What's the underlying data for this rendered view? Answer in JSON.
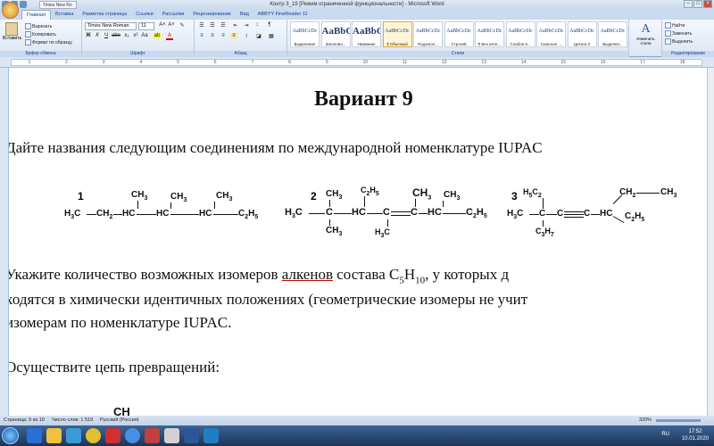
{
  "titlebar": {
    "doc_tab": "Times New Ro",
    "title": "Контр 3_19 [Режим ограниченной функциональности] - Microsoft Word"
  },
  "tabs": [
    "Главная",
    "Вставка",
    "Разметка страницы",
    "Ссылки",
    "Рассылки",
    "Рецензирование",
    "Вид",
    "ABBYY FineReader 11"
  ],
  "ribbon": {
    "paste": "Вставить",
    "cut": "Вырезать",
    "copy": "Копировать",
    "format_painter": "Формат по образцу",
    "font_name": "Times New Roman",
    "font_size": "11",
    "groups": [
      "Буфер обмена",
      "Шрифт",
      "Абзац",
      "Стили",
      "Редактирование"
    ],
    "styles": [
      {
        "sample": "AaBbCcDc",
        "name": "Выделение"
      },
      {
        "sample": "AaBbC",
        "name": "Заголово..."
      },
      {
        "sample": "AaBbC",
        "name": "Название"
      },
      {
        "sample": "AaBbCcDc",
        "name": "¶ Обычный"
      },
      {
        "sample": "AaBbCcDc",
        "name": "Подзагол..."
      },
      {
        "sample": "AaBbCcDc",
        "name": "Строгий"
      },
      {
        "sample": "AaBbCcDc",
        "name": "¶ Без инте..."
      },
      {
        "sample": "AaBbCcDc",
        "name": "Слабое в..."
      },
      {
        "sample": "AaBbCcDc",
        "name": "Сильное ..."
      },
      {
        "sample": "AaBbCcDc",
        "name": "Цитата 2"
      },
      {
        "sample": "AaBbCcDc",
        "name": "Выделен..."
      }
    ],
    "change_styles": "Изменить стили",
    "find": "Найти",
    "replace": "Заменить",
    "select": "Выделить"
  },
  "ruler_numbers": [
    "1",
    "2",
    "3",
    "4",
    "5",
    "6",
    "7",
    "8",
    "9",
    "10",
    "11",
    "12",
    "13",
    "14",
    "15",
    "16",
    "17",
    "18"
  ],
  "document": {
    "heading": "Вариант 9",
    "task1": "Дайте названия следующим соединениям по международной номенклатуре IUPAC",
    "compound_numbers": [
      "1",
      "2",
      "3"
    ],
    "task2_line1_a": "Укажите количество возможных изомеров ",
    "task2_line1_link": "алкенов",
    "task2_line1_b": " состава C",
    "task2_line1_sub1": "5",
    "task2_line1_c": "H",
    "task2_line1_sub2": "10",
    "task2_line1_d": ", у которых д",
    "task2_line2": "ходятся в химически идентичных положениях (геометрические изомеры не учит",
    "task2_line3": "изомерам по номенклатуре IUPAC.",
    "task3": "Осуществите цепь превращений:",
    "bottom_fragment": "CH"
  },
  "status": {
    "page": "Страница: 9 из 10",
    "words": "Число слов: 1 519",
    "lang": "Русский (Россия)",
    "zoom": "320%"
  },
  "taskbar": {
    "time": "17:52",
    "date": "10.01.2020",
    "lang": "RU"
  }
}
